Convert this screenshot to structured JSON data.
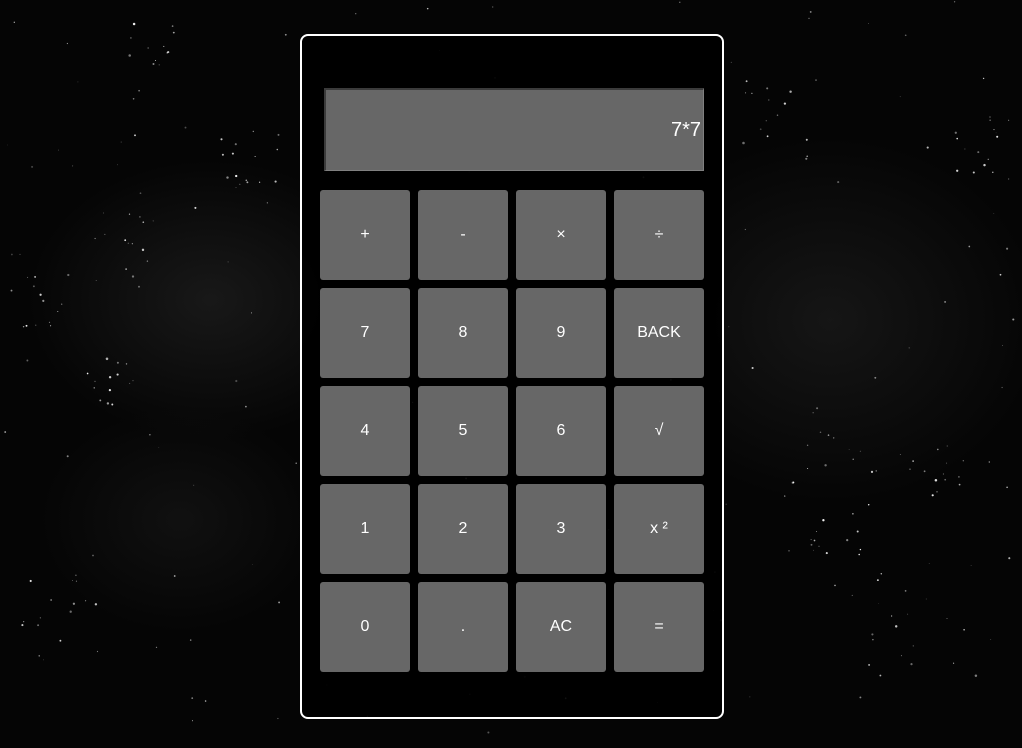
{
  "display": {
    "value": "7*7"
  },
  "keys": [
    {
      "label": "+",
      "name": "add-button"
    },
    {
      "label": "-",
      "name": "subtract-button"
    },
    {
      "label": "×",
      "name": "multiply-button"
    },
    {
      "label": "÷",
      "name": "divide-button"
    },
    {
      "label": "7",
      "name": "digit-7-button"
    },
    {
      "label": "8",
      "name": "digit-8-button"
    },
    {
      "label": "9",
      "name": "digit-9-button"
    },
    {
      "label": "BACK",
      "name": "backspace-button"
    },
    {
      "label": "4",
      "name": "digit-4-button"
    },
    {
      "label": "5",
      "name": "digit-5-button"
    },
    {
      "label": "6",
      "name": "digit-6-button"
    },
    {
      "label": "√",
      "name": "square-root-button"
    },
    {
      "label": "1",
      "name": "digit-1-button"
    },
    {
      "label": "2",
      "name": "digit-2-button"
    },
    {
      "label": "3",
      "name": "digit-3-button"
    },
    {
      "label": "x ²",
      "name": "square-button"
    },
    {
      "label": "0",
      "name": "digit-0-button"
    },
    {
      "label": ".",
      "name": "decimal-point-button"
    },
    {
      "label": "AC",
      "name": "all-clear-button"
    },
    {
      "label": "=",
      "name": "equals-button"
    }
  ],
  "colors": {
    "background": "#000000",
    "key": "#676767",
    "display": "#676767",
    "border": "#ffffff",
    "text": "#ffffff"
  }
}
